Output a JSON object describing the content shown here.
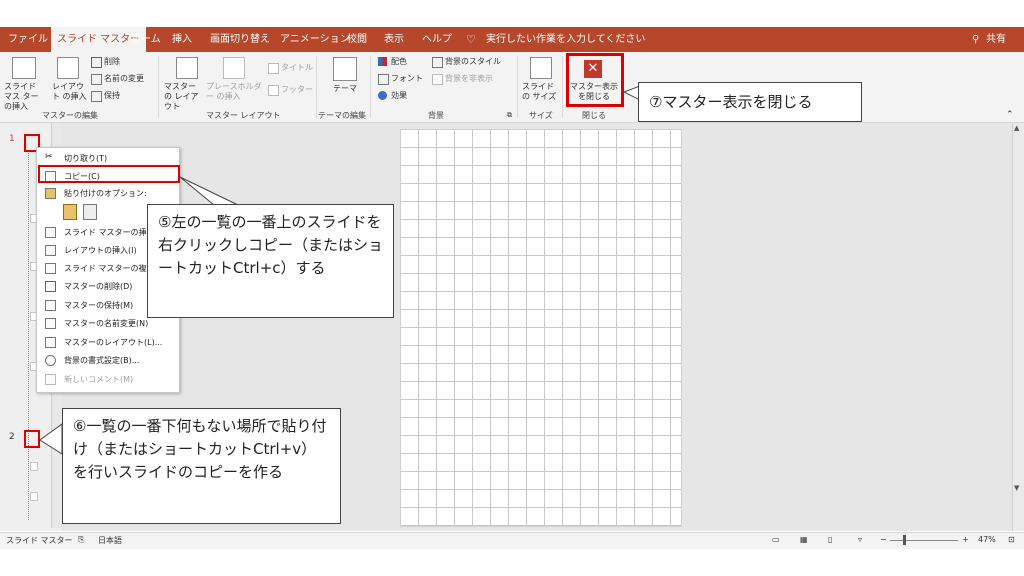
{
  "tabs": [
    "ファイル",
    "スライド マスター",
    "ホーム",
    "挿入",
    "画面切り替え",
    "アニメーション",
    "校閲",
    "表示",
    "ヘルプ"
  ],
  "tell_me": "実行したい作業を入力してください",
  "share": "共有",
  "ribbon": {
    "insert_master": "スライド マス ターの挿入",
    "insert_layout": "レイアウト の挿入",
    "delete": "削除",
    "rename": "名前の変更",
    "preserve": "保持",
    "group_edit_master": "マスターの編集",
    "master_layout": "マスターの レイアウト",
    "insert_placeholder": "プレースホルダー の挿入",
    "title": "タイトル",
    "footer": "フッター",
    "group_master_layout": "マスター レイアウト",
    "theme": "テーマ",
    "group_edit_theme": "テーマの編集",
    "colors": "配色",
    "fonts": "フォント",
    "effects": "効果",
    "bg_styles": "背景のスタイル",
    "hide_bg": "背景を非表示",
    "group_background": "背景",
    "slide_size": "スライドの サイズ",
    "group_size": "サイズ",
    "close_master": "マスター表示 を閉じる",
    "group_close": "閉じる"
  },
  "thumbs": {
    "n1": "1",
    "n2": "2"
  },
  "context_menu": {
    "items": [
      "切り取り(T)",
      "コピー(C)",
      "貼り付けのオプション:",
      "スライド マスターの挿入(",
      "レイアウトの挿入(I)",
      "スライド マスターの複製(",
      "マスターの削除(D)",
      "マスターの保持(M)",
      "マスターの名前変更(N)",
      "マスターのレイアウト(L)...",
      "背景の書式設定(B)...",
      "新しいコメント(M)"
    ]
  },
  "callouts": {
    "c5": "⑤左の一覧の一番上のスライドを右クリックしコピー（またはショートカットCtrl+c）する",
    "c6": "⑥一覧の一番下何もない場所で貼り付け（またはショートカットCtrl+v）を行いスライドのコピーを作る",
    "c7": "⑦マスター表示を閉じる"
  },
  "status": {
    "mode": "スライド マスター",
    "lang": "日本語",
    "zoom": "47%"
  },
  "colors": {
    "accent": "#b7472a",
    "highlight": "#dd0000"
  }
}
